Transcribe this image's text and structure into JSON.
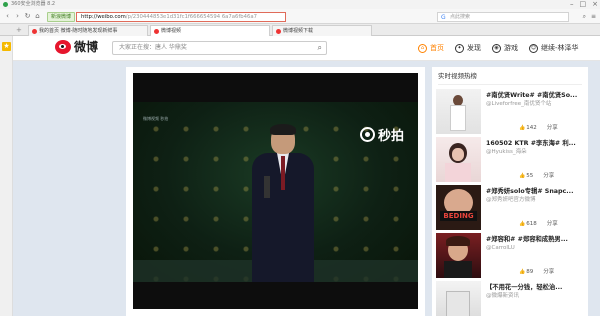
{
  "browser": {
    "title": "360安全浏览器 8.2",
    "secure_label": "新浪微博",
    "url_host": "http://weibo.com",
    "url_path": "/p/230444853e1d31fc1f666654594 6a7a6fb46a7",
    "search_placeholder": "点此搜索",
    "tabs": [
      {
        "label": "我的首页 微博-随时随地发现新鲜事"
      },
      {
        "label": "微博视频"
      },
      {
        "label": "微博视频下载"
      }
    ]
  },
  "weibo": {
    "logo_text": "微博",
    "search_placeholder": "大家正在搜：唐人 华鼎奖",
    "nav": [
      {
        "label": "首页"
      },
      {
        "label": "发现"
      },
      {
        "label": "游戏"
      },
      {
        "label": "继续-林泽华"
      }
    ]
  },
  "player": {
    "small_mark": "微博视频 秒拍",
    "watermark": "秒拍"
  },
  "sidebar": {
    "title": "实时视频热榜",
    "items": [
      {
        "title": "#南优贤Write# #南优贤So...",
        "author": "@Liveforfree_南优贤个站",
        "likes": "142",
        "share": "分享"
      },
      {
        "title": "160502 KTR #李东海# 利...",
        "author": "@Hyukiss_海朵",
        "likes": "55",
        "share": "分享"
      },
      {
        "title": "#郑秀妍solo专辑# Snapc...",
        "author": "@郑秀妍吧官方微博",
        "likes": "618",
        "share": "分享"
      },
      {
        "title": "#郑容和# #郑容和成熟男...",
        "author": "@CarrolLU",
        "likes": "89",
        "share": "分享"
      },
      {
        "title": "【不用花一分钱，轻松治...",
        "author": "@微爆新资讯",
        "likes": "",
        "share": ""
      }
    ]
  }
}
